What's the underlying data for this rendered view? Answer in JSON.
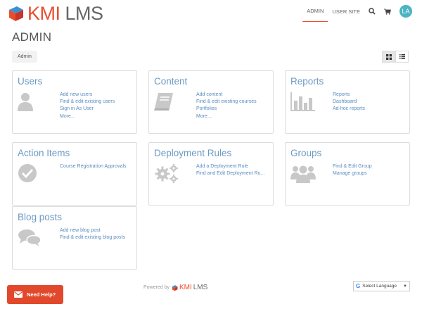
{
  "header": {
    "logo_k": "KMI",
    "logo_rest": "LMS",
    "nav": {
      "admin": "ADMIN",
      "user_site": "USER SITE",
      "avatar": "LA"
    }
  },
  "page": {
    "title": "ADMIN",
    "breadcrumb": "Admin"
  },
  "cards": {
    "users": {
      "title": "Users",
      "links": [
        "Add new users",
        "Find & edit existing users",
        "Sign in As User",
        "More..."
      ]
    },
    "content": {
      "title": "Content",
      "links": [
        "Add content",
        "Find & edit existing courses",
        "Portfolios",
        "More..."
      ]
    },
    "reports": {
      "title": "Reports",
      "links": [
        "Reports",
        "Dashboard",
        "Ad-hoc reports"
      ]
    },
    "actions": {
      "title": "Action Items",
      "links": [
        "Course Registration Approvals"
      ]
    },
    "deployment": {
      "title": "Deployment Rules",
      "links": [
        "Add a Deployment Rule",
        "Find and Edit Deployment Ru..."
      ]
    },
    "groups": {
      "title": "Groups",
      "links": [
        "Find & Edit Group",
        "Manage groups"
      ]
    },
    "blog": {
      "title": "Blog posts",
      "links": [
        "Add new blog post",
        "Find & edit existing blog posts"
      ]
    }
  },
  "footer": {
    "powered": "Powered by",
    "brand_k": "KMI",
    "brand_rest": "LMS"
  },
  "language": {
    "label": "Select Language"
  },
  "help": {
    "label": "Need Help?"
  },
  "colors": {
    "accent": "#e84e2e",
    "link": "#5a8bc0",
    "title": "#6d9ac4",
    "avatar": "#4cb3c3"
  }
}
